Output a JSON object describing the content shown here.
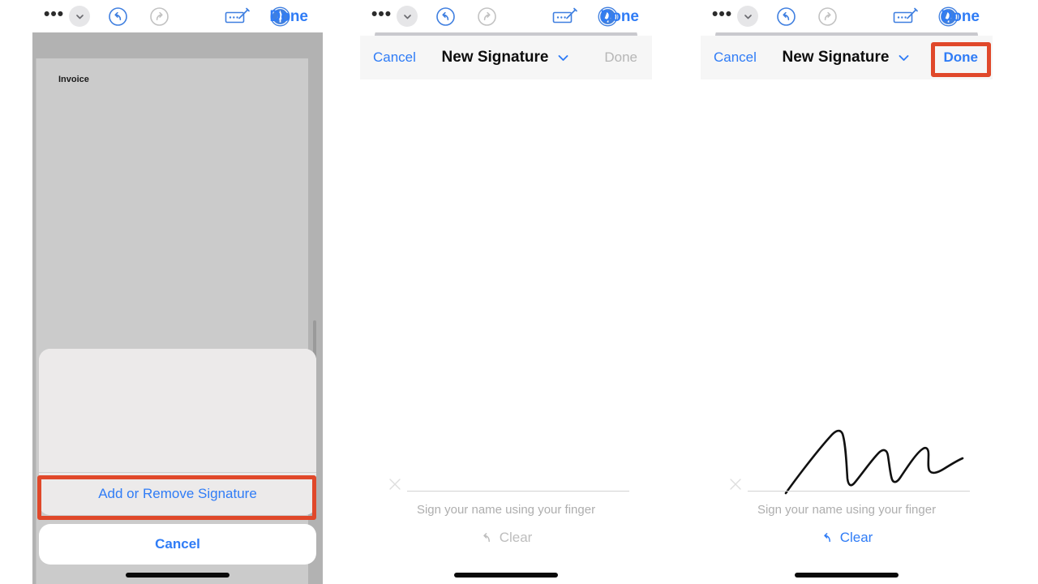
{
  "toolbar": {
    "more_label": "•••",
    "icons": {
      "more": "ellipsis-icon",
      "chevron_down": "chevron-down-icon",
      "undo": "undo-icon",
      "redo": "redo-icon",
      "markup": "markup-pencil-icon",
      "signature": "signature-pen-badge-icon"
    },
    "done_label": "Done"
  },
  "panel1": {
    "document": {
      "title": "Invoice"
    },
    "action_sheet": {
      "add_remove_signature": "Add or Remove Signature",
      "cancel": "Cancel"
    }
  },
  "panel2": {
    "sheet": {
      "cancel": "Cancel",
      "title": "New Signature",
      "chevron": "chevron-down-icon",
      "done": "Done",
      "done_enabled": false
    },
    "signature": {
      "hint": "Sign your name using your finger",
      "clear": "Clear",
      "clear_enabled": false,
      "has_stroke": false
    }
  },
  "panel3": {
    "sheet": {
      "cancel": "Cancel",
      "title": "New Signature",
      "chevron": "chevron-down-icon",
      "done": "Done",
      "done_enabled": true
    },
    "signature": {
      "hint": "Sign your name using your finger",
      "clear": "Clear",
      "clear_enabled": true,
      "has_stroke": true
    }
  },
  "annotations": {
    "highlight_color": "#e0482a",
    "targets": [
      "Add or Remove Signature",
      "Done"
    ]
  },
  "colors": {
    "accent_blue": "#2f7cf6",
    "disabled_gray": "#b6b6b6",
    "backdrop_gray": "#b2b2b2",
    "page_gray": "#cbcbcb",
    "sheet_gray": "#eceaea"
  }
}
